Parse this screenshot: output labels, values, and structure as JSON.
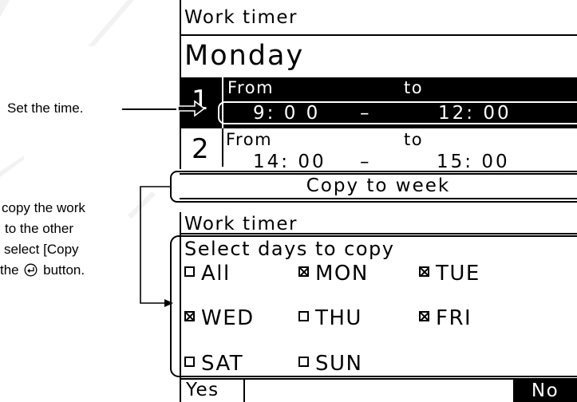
{
  "screen1": {
    "title": "Work timer",
    "day": "Monday",
    "slots": [
      {
        "number": "1",
        "from_label": "From",
        "to_label": "to",
        "from_time": "9: 0 0",
        "dash": "–",
        "to_time": "12: 00"
      },
      {
        "number": "2",
        "from_label": "From",
        "to_label": "to",
        "from_time": "14: 00",
        "dash": "–",
        "to_time": "15: 00"
      }
    ],
    "copy_button": "Copy to week"
  },
  "screen2": {
    "title": "Work timer",
    "prompt": "Select days to copy",
    "days": [
      {
        "label": "All",
        "checked": false
      },
      {
        "label": "MON",
        "checked": true
      },
      {
        "label": "TUE",
        "checked": true
      },
      {
        "label": "WED",
        "checked": true
      },
      {
        "label": "THU",
        "checked": false
      },
      {
        "label": "FRI",
        "checked": true
      },
      {
        "label": "SAT",
        "checked": false
      },
      {
        "label": "SUN",
        "checked": false
      }
    ],
    "yes_label": "Yes",
    "no_label": "No"
  },
  "annotations": {
    "set_time": "Set the time.",
    "copy_lines": [
      "copy the work",
      "to the other",
      "select [Copy",
      "the",
      "button."
    ]
  },
  "icons": {
    "enter_button": "enter-icon",
    "cursor_arrow": "arrow-cursor-icon"
  }
}
